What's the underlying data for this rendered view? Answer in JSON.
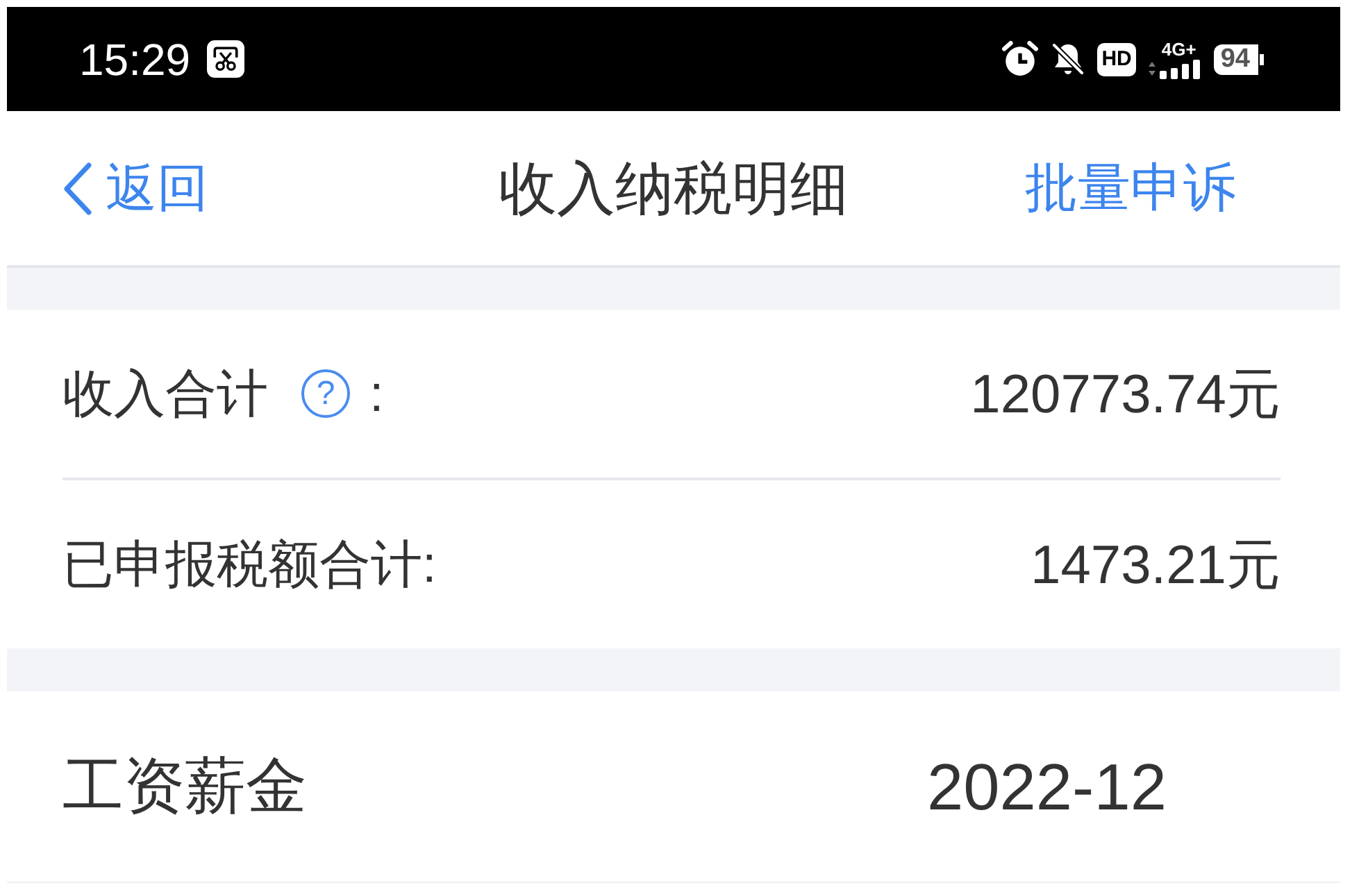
{
  "status_bar": {
    "time": "15:29",
    "hd_label": "HD",
    "network": "4G+",
    "battery": "94"
  },
  "nav": {
    "back": "返回",
    "title": "收入纳税明细",
    "action": "批量申诉"
  },
  "summary": [
    {
      "label": "收入合计",
      "help": "?",
      "suffix": ":",
      "value": "120773.74元"
    },
    {
      "label": "已申报税额合计:",
      "value": "1473.21元"
    }
  ],
  "records": [
    {
      "category": "工资薪金",
      "period": "2022-12"
    }
  ]
}
